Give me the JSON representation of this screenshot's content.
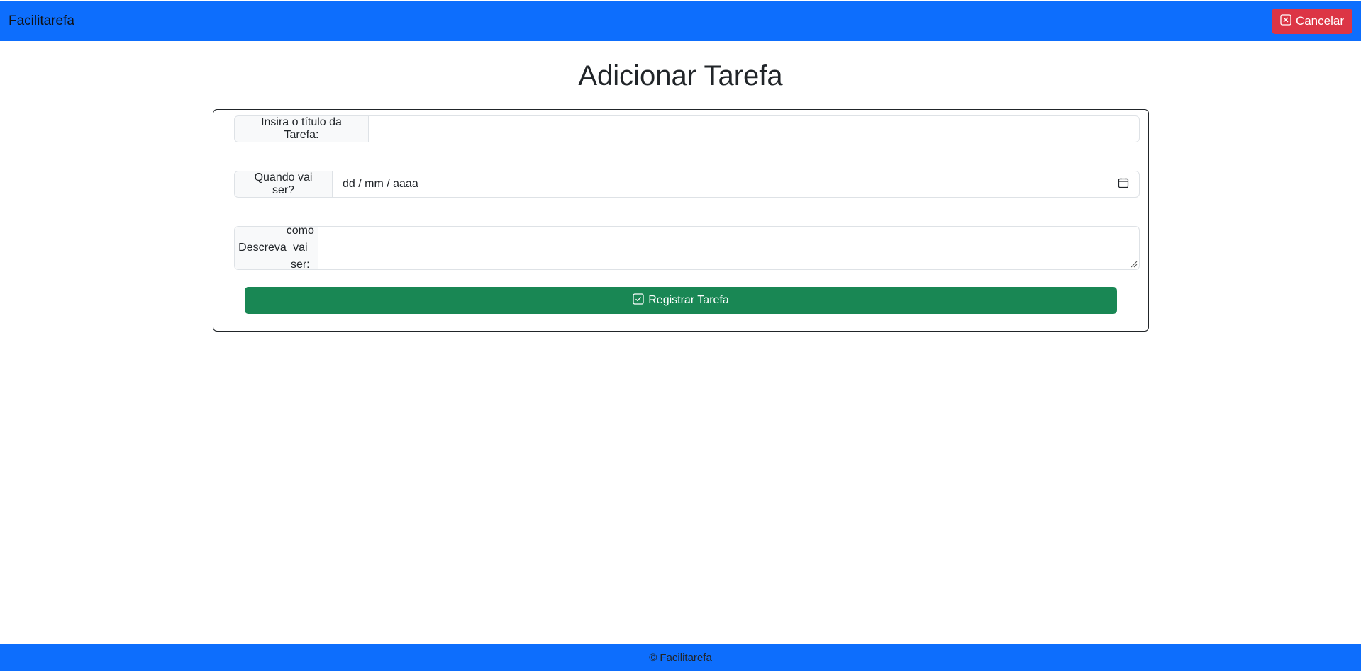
{
  "navbar": {
    "brand": "Facilitarefa",
    "cancel_label": "Cancelar"
  },
  "page": {
    "title": "Adicionar Tarefa"
  },
  "form": {
    "title_label": "Insira o título da Tarefa:",
    "title_value": "",
    "date_label": "Quando vai ser?",
    "date_placeholder": "dd / mm / aaaa",
    "desc_label_line1": "Descreva",
    "desc_label_line2": "como vai ser:",
    "desc_value": "",
    "submit_label": "Registrar Tarefa"
  },
  "footer": {
    "text": "© Facilitarefa"
  },
  "icons": {
    "cancel": "x-square-icon",
    "submit": "check-square-icon",
    "date": "calendar-icon"
  },
  "colors": {
    "primary": "#0d6efd",
    "danger": "#dc3545",
    "success": "#198754"
  }
}
